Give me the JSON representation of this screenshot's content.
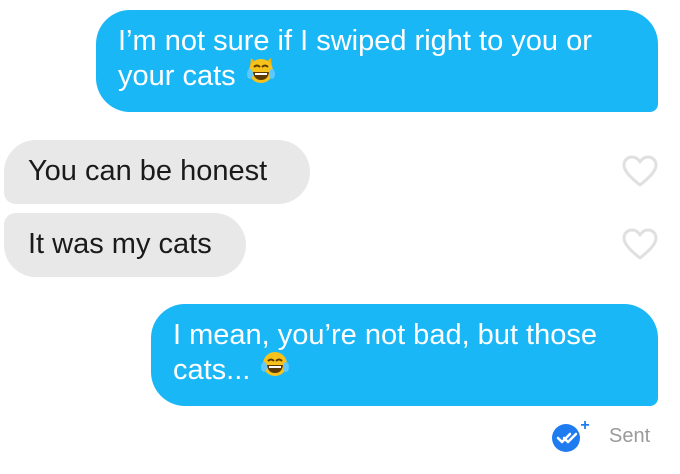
{
  "messages": [
    {
      "lines": [
        "I’m not sure if I swiped right to you or",
        "your cats"
      ],
      "direction": "sent",
      "emoji": "crying-laughing-cat-icon"
    },
    {
      "lines": [
        "You can be honest"
      ],
      "direction": "received"
    },
    {
      "lines": [
        "It was my cats"
      ],
      "direction": "received"
    },
    {
      "lines": [
        "I mean, you’re not bad, but those",
        "cats..."
      ],
      "direction": "sent",
      "emoji": "tears-of-joy-icon"
    }
  ],
  "status": {
    "sent_label": "Sent",
    "badge_plus": "+"
  },
  "colors": {
    "sent_bubble": "#1ab7f7",
    "received_bubble": "#e8e8e8",
    "heart_outline": "#e0e0e0",
    "status_text": "#9a9a9a",
    "badge": "#1e7cf0"
  }
}
